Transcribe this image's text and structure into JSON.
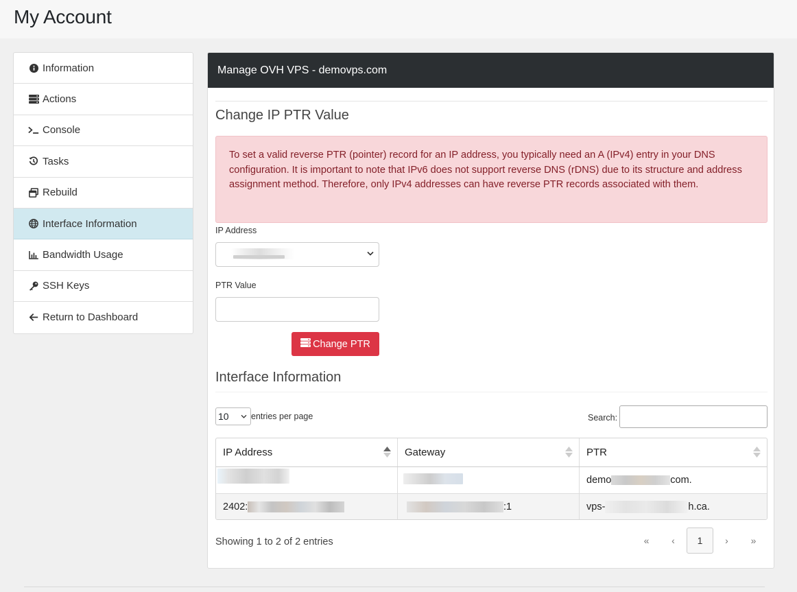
{
  "page": {
    "title": "My Account"
  },
  "sidebar": {
    "items": [
      {
        "label": "Information",
        "icon": "info-circle-icon",
        "active": false
      },
      {
        "label": "Actions",
        "icon": "server-icon",
        "active": false
      },
      {
        "label": "Console",
        "icon": "terminal-icon",
        "active": false
      },
      {
        "label": "Tasks",
        "icon": "history-icon",
        "active": false
      },
      {
        "label": "Rebuild",
        "icon": "window-restore-icon",
        "active": false
      },
      {
        "label": "Interface Information",
        "icon": "globe-icon",
        "active": true
      },
      {
        "label": "Bandwidth Usage",
        "icon": "bar-chart-icon",
        "active": false
      },
      {
        "label": "SSH Keys",
        "icon": "key-icon",
        "active": false
      },
      {
        "label": "Return to Dashboard",
        "icon": "arrow-left-icon",
        "active": false
      }
    ]
  },
  "card": {
    "header": "Manage OVH VPS - demovps.com"
  },
  "ptr_section": {
    "title": "Change IP PTR Value",
    "alert": "To set a valid reverse PTR (pointer) record for an IP address, you typically need an A (IPv4) entry in your DNS configuration. It is important to note that IPv6 does not support reverse DNS (rDNS) due to its structure and address assignment method. Therefore, only IPv4 addresses can have reverse PTR records associated with them.",
    "ip_label": "IP Address",
    "ip_value": "",
    "ptr_label": "PTR Value",
    "ptr_value": "",
    "button_label": "Change PTR"
  },
  "interface_section": {
    "title": "Interface Information",
    "length_value": "10",
    "length_label": "entries per page",
    "search_label": "Search:",
    "search_value": "",
    "columns": [
      "IP Address",
      "Gateway",
      "PTR"
    ],
    "rows": [
      {
        "ip": "",
        "gateway": "",
        "ptr_start": "demo",
        "ptr_end": "com."
      },
      {
        "ip": "2402:",
        "gateway": "",
        "gateway_end": ":1",
        "ptr_start": "vps-",
        "ptr_end": "h.ca."
      }
    ],
    "info": "Showing 1 to 2 of 2 entries",
    "pagination": [
      "«",
      "‹",
      "1",
      "›",
      "»"
    ],
    "current_page": "1"
  },
  "colors": {
    "accent_danger": "#dc3545",
    "header_dark": "#2b2f32",
    "active_item": "#d1e9f0"
  }
}
